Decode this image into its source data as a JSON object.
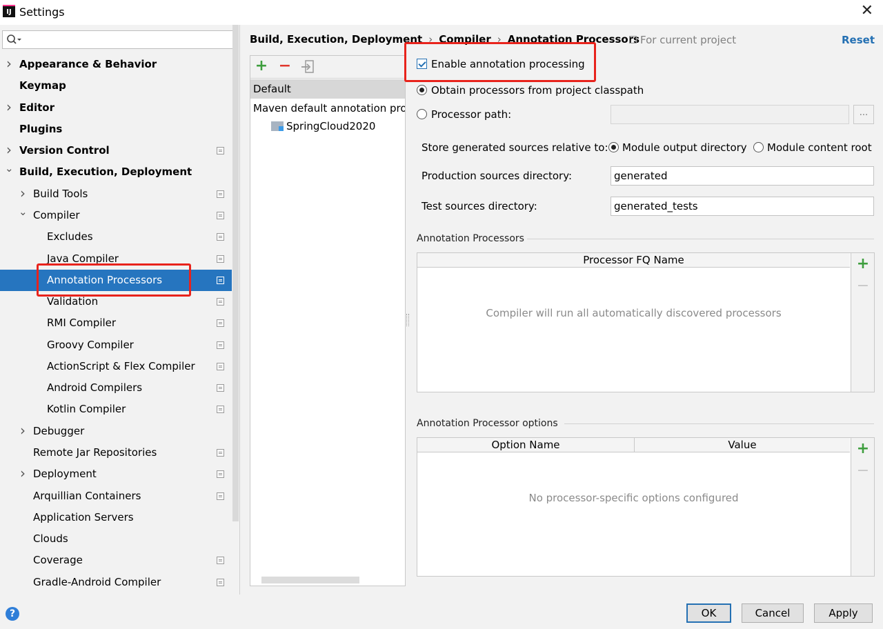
{
  "window": {
    "title": "Settings",
    "app_icon": "IJ"
  },
  "search": {
    "placeholder": ""
  },
  "sidebar": {
    "items": [
      {
        "label": "Appearance & Behavior",
        "arrow": "right",
        "bold": true,
        "proj": false
      },
      {
        "label": "Keymap",
        "arrow": "",
        "bold": true,
        "proj": false
      },
      {
        "label": "Editor",
        "arrow": "right",
        "bold": true,
        "proj": false
      },
      {
        "label": "Plugins",
        "arrow": "",
        "bold": true,
        "proj": false
      },
      {
        "label": "Version Control",
        "arrow": "right",
        "bold": true,
        "proj": true
      },
      {
        "label": "Build, Execution, Deployment",
        "arrow": "down",
        "bold": true,
        "proj": false
      },
      {
        "label": "Build Tools",
        "arrow": "right",
        "bold": false,
        "proj": true
      },
      {
        "label": "Compiler",
        "arrow": "down",
        "bold": false,
        "proj": true
      },
      {
        "label": "Excludes",
        "arrow": "",
        "bold": false,
        "proj": true
      },
      {
        "label": "Java Compiler",
        "arrow": "",
        "bold": false,
        "proj": true
      },
      {
        "label": "Annotation Processors",
        "arrow": "",
        "bold": false,
        "proj": true,
        "selected": true
      },
      {
        "label": "Validation",
        "arrow": "",
        "bold": false,
        "proj": true
      },
      {
        "label": "RMI Compiler",
        "arrow": "",
        "bold": false,
        "proj": true
      },
      {
        "label": "Groovy Compiler",
        "arrow": "",
        "bold": false,
        "proj": true
      },
      {
        "label": "ActionScript & Flex Compiler",
        "arrow": "",
        "bold": false,
        "proj": true
      },
      {
        "label": "Android Compilers",
        "arrow": "",
        "bold": false,
        "proj": true
      },
      {
        "label": "Kotlin Compiler",
        "arrow": "",
        "bold": false,
        "proj": true
      },
      {
        "label": "Debugger",
        "arrow": "right",
        "bold": false,
        "proj": false
      },
      {
        "label": "Remote Jar Repositories",
        "arrow": "",
        "bold": false,
        "proj": true
      },
      {
        "label": "Deployment",
        "arrow": "right",
        "bold": false,
        "proj": true
      },
      {
        "label": "Arquillian Containers",
        "arrow": "",
        "bold": false,
        "proj": true
      },
      {
        "label": "Application Servers",
        "arrow": "",
        "bold": false,
        "proj": false
      },
      {
        "label": "Clouds",
        "arrow": "",
        "bold": false,
        "proj": false
      },
      {
        "label": "Coverage",
        "arrow": "",
        "bold": false,
        "proj": true
      },
      {
        "label": "Gradle-Android Compiler",
        "arrow": "",
        "bold": false,
        "proj": true
      }
    ]
  },
  "breadcrumb": {
    "part1": "Build, Execution, Deployment",
    "part2": "Compiler",
    "part3": "Annotation Processors",
    "sep": "›"
  },
  "header": {
    "for_project": "For current project",
    "reset": "Reset"
  },
  "profiles": {
    "default_label": "Default",
    "maven_label": "Maven default annotation processors profile",
    "module_label": "SpringCloud2020"
  },
  "form": {
    "enable_label": "Enable annotation processing",
    "obtain_label": "Obtain processors from project classpath",
    "processor_path_label": "Processor path:",
    "processor_path_value": "",
    "store_label": "Store generated sources relative to:",
    "module_output_label": "Module output directory",
    "module_content_label": "Module content root",
    "prod_label": "Production sources directory:",
    "prod_value": "generated",
    "test_label": "Test sources directory:",
    "test_value": "generated_tests",
    "browse_label": "..."
  },
  "processors_group": {
    "title": "Annotation Processors",
    "column": "Processor FQ Name",
    "empty": "Compiler will run all automatically discovered processors"
  },
  "options_group": {
    "title": "Annotation Processor options",
    "col_name": "Option Name",
    "col_value": "Value",
    "empty": "No processor-specific options configured"
  },
  "buttons": {
    "ok": "OK",
    "cancel": "Cancel",
    "apply": "Apply",
    "help": "?"
  },
  "icons": {
    "plus": "+",
    "minus": "−",
    "close": "✕"
  },
  "colors": {
    "selection": "#2675bf",
    "accent": "#2470b3",
    "highlight": "#e8231c",
    "add": "#3e9e3e",
    "remove": "#e0362c"
  }
}
